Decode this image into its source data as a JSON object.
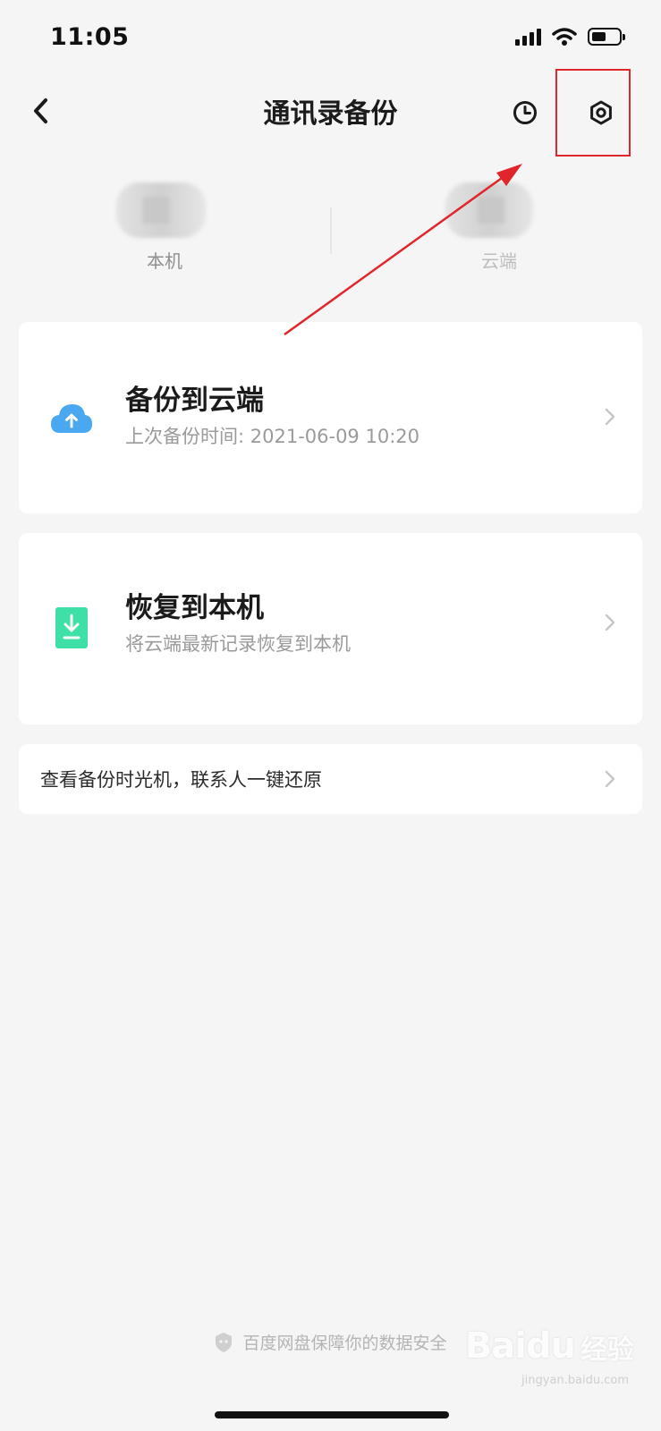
{
  "status_bar": {
    "time": "11:05"
  },
  "header": {
    "title": "通讯录备份"
  },
  "counts": {
    "local_label": "本机",
    "cloud_label": "云端"
  },
  "backup_card": {
    "title": "备份到云端",
    "subtitle": "上次备份时间: 2021-06-09 10:20"
  },
  "restore_card": {
    "title": "恢复到本机",
    "subtitle": "将云端最新记录恢复到本机"
  },
  "time_machine": {
    "label": "查看备份时光机，联系人一键还原"
  },
  "footer": {
    "text": "百度网盘保障你的数据安全"
  },
  "watermark": {
    "logo": "Baidu",
    "cn": "经验",
    "url": "jingyan.baidu.com"
  },
  "icons": {
    "back": "chevron-left-icon",
    "history": "clock-icon",
    "settings": "hexagon-gear-icon",
    "backup": "cloud-upload-icon",
    "restore": "download-file-icon",
    "chevron": "chevron-right-icon",
    "shield": "shield-icon"
  },
  "colors": {
    "background": "#f5f5f5",
    "card": "#ffffff",
    "annotation_red": "#e0262b",
    "cloud_blue": "#4aa8f0",
    "restore_green": "#3ee0a8"
  }
}
